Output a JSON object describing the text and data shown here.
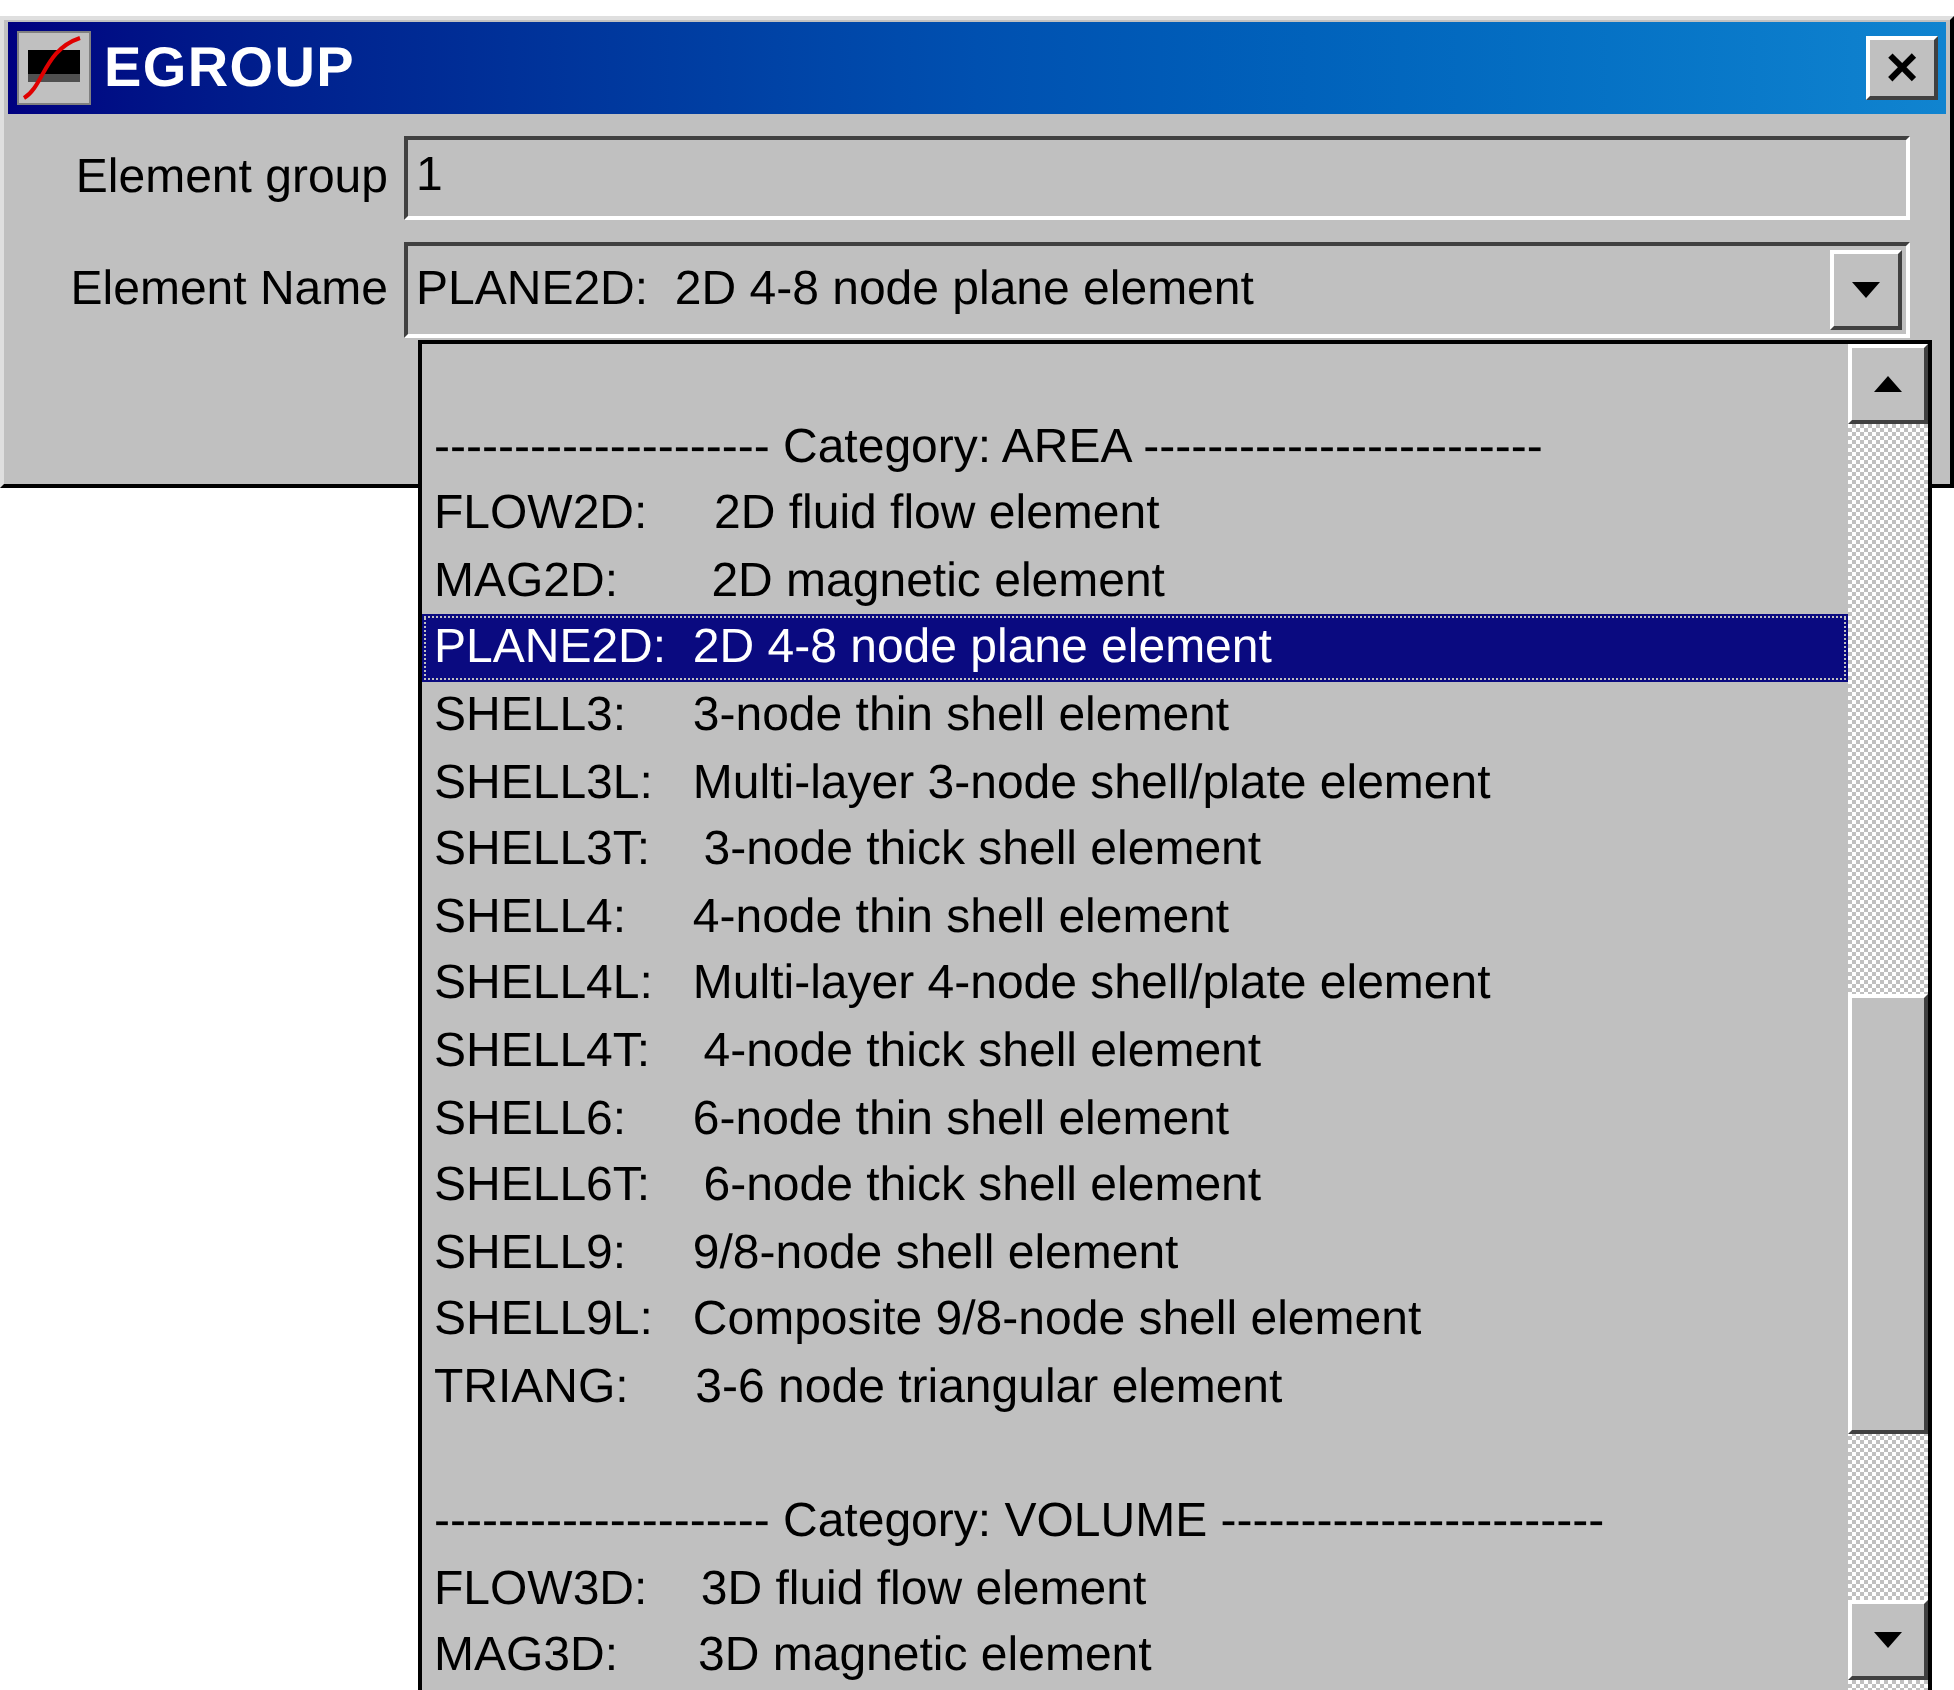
{
  "window": {
    "title": "EGROUP",
    "close": "×"
  },
  "fields": [
    {
      "label": "Element group",
      "value": "1"
    },
    {
      "label": "Element Name",
      "value": "PLANE2D:  2D 4-8 node plane element"
    }
  ],
  "dropdown": {
    "items": [
      {
        "kind": "category",
        "text": "--------------------- Category: AREA -------------------------",
        "selected": false
      },
      {
        "kind": "option",
        "text": "FLOW2D:     2D fluid flow element",
        "selected": false
      },
      {
        "kind": "option",
        "text": "MAG2D:       2D magnetic element",
        "selected": false
      },
      {
        "kind": "option",
        "text": "PLANE2D:  2D 4-8 node plane element",
        "selected": true
      },
      {
        "kind": "option",
        "text": "SHELL3:     3-node thin shell element",
        "selected": false
      },
      {
        "kind": "option",
        "text": "SHELL3L:   Multi-layer 3-node shell/plate element",
        "selected": false
      },
      {
        "kind": "option",
        "text": "SHELL3T:    3-node thick shell element",
        "selected": false
      },
      {
        "kind": "option",
        "text": "SHELL4:     4-node thin shell element",
        "selected": false
      },
      {
        "kind": "option",
        "text": "SHELL4L:   Multi-layer 4-node shell/plate element",
        "selected": false
      },
      {
        "kind": "option",
        "text": "SHELL4T:    4-node thick shell element",
        "selected": false
      },
      {
        "kind": "option",
        "text": "SHELL6:     6-node thin shell element",
        "selected": false
      },
      {
        "kind": "option",
        "text": "SHELL6T:    6-node thick shell element",
        "selected": false
      },
      {
        "kind": "option",
        "text": "SHELL9:     9/8-node shell element",
        "selected": false
      },
      {
        "kind": "option",
        "text": "SHELL9L:   Composite 9/8-node shell element",
        "selected": false
      },
      {
        "kind": "option",
        "text": "TRIANG:     3-6 node triangular element",
        "selected": false
      },
      {
        "kind": "category",
        "text": "--------------------- Category: VOLUME ------------------------",
        "selected": false
      },
      {
        "kind": "option",
        "text": "FLOW3D:    3D fluid flow element",
        "selected": false
      },
      {
        "kind": "option",
        "text": "MAG3D:      3D magnetic element",
        "selected": false
      }
    ]
  }
}
